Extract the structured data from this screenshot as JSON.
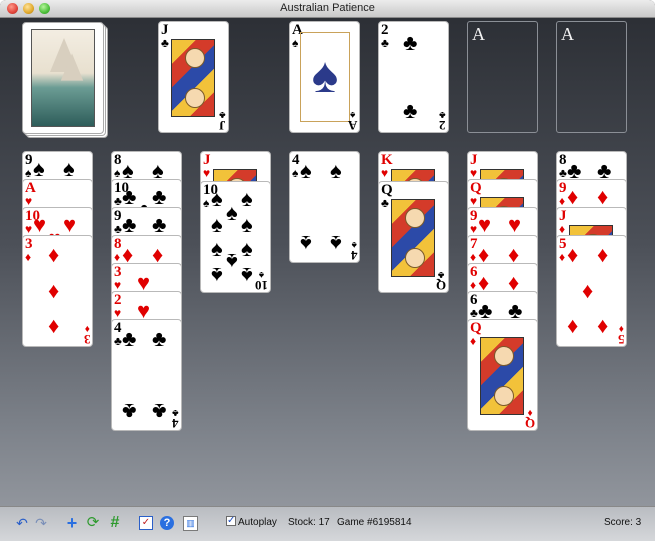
{
  "window": {
    "title": "Australian Patience"
  },
  "foundations": [
    {
      "label": "A"
    },
    {
      "label": "A"
    }
  ],
  "waste": {
    "jack": {
      "rank": "J",
      "suit": "♣",
      "color": "b"
    },
    "ace": {
      "rank": "A",
      "suit": "♠",
      "color": "b"
    },
    "two": {
      "rank": "2",
      "suit": "♣",
      "color": "b"
    }
  },
  "tableau": [
    [
      {
        "rank": "9",
        "suit": "♠",
        "color": "b"
      },
      {
        "rank": "A",
        "suit": "♥",
        "color": "r"
      },
      {
        "rank": "10",
        "suit": "♥",
        "color": "r"
      },
      {
        "rank": "3",
        "suit": "♦",
        "color": "r"
      }
    ],
    [
      {
        "rank": "8",
        "suit": "♠",
        "color": "b"
      },
      {
        "rank": "10",
        "suit": "♣",
        "color": "b"
      },
      {
        "rank": "9",
        "suit": "♣",
        "color": "b"
      },
      {
        "rank": "8",
        "suit": "♦",
        "color": "r"
      },
      {
        "rank": "3",
        "suit": "♥",
        "color": "r"
      },
      {
        "rank": "2",
        "suit": "♥",
        "color": "r"
      },
      {
        "rank": "4",
        "suit": "♣",
        "color": "b"
      }
    ],
    [
      {
        "rank": "J",
        "suit": "♥",
        "color": "r"
      },
      {
        "rank": "10",
        "suit": "♠",
        "color": "b"
      }
    ],
    [
      {
        "rank": "4",
        "suit": "♠",
        "color": "b"
      }
    ],
    [
      {
        "rank": "K",
        "suit": "♥",
        "color": "r"
      },
      {
        "rank": "Q",
        "suit": "♣",
        "color": "b"
      }
    ],
    [
      {
        "rank": "J",
        "suit": "♥",
        "color": "r"
      },
      {
        "rank": "Q",
        "suit": "♥",
        "color": "r"
      },
      {
        "rank": "9",
        "suit": "♥",
        "color": "r"
      },
      {
        "rank": "7",
        "suit": "♦",
        "color": "r"
      },
      {
        "rank": "6",
        "suit": "♦",
        "color": "r"
      },
      {
        "rank": "6",
        "suit": "♣",
        "color": "b"
      },
      {
        "rank": "Q",
        "suit": "♦",
        "color": "r"
      }
    ],
    [
      {
        "rank": "8",
        "suit": "♣",
        "color": "b"
      },
      {
        "rank": "9",
        "suit": "♦",
        "color": "r"
      },
      {
        "rank": "J",
        "suit": "♦",
        "color": "r"
      },
      {
        "rank": "5",
        "suit": "♦",
        "color": "r"
      }
    ]
  ],
  "toolbar": {
    "undo_icon": "undo-arrow-icon",
    "redo_icon": "redo-arrow-icon",
    "new_icon": "plus-icon",
    "restart_icon": "refresh-icon",
    "select_icon": "hash-icon",
    "checklist_icon": "checklist-icon",
    "help_icon": "help-icon",
    "stats_icon": "chart-icon",
    "autoplay_label": "Autoplay",
    "autoplay_checked": true,
    "stock_text": "Stock: 17",
    "game_text": "Game #6195814",
    "score_text": "Score: 3"
  }
}
